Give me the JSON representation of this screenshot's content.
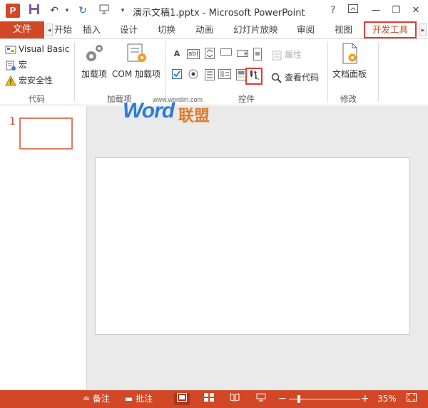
{
  "title_bar": {
    "app_badge": "P",
    "title": "演示文稿1.pptx - Microsoft PowerPoint",
    "help": "?",
    "minimize": "—",
    "restore": "❐",
    "close": "✕"
  },
  "tabs": {
    "file": "文件",
    "items": [
      "开始",
      "插入",
      "设计",
      "切换",
      "动画",
      "幻灯片放映",
      "审阅",
      "视图",
      "开发工具"
    ],
    "active": "开发工具"
  },
  "ribbon": {
    "code_group": {
      "label": "代码",
      "visual_basic": "Visual Basic",
      "macros": "宏",
      "macro_security": "宏安全性"
    },
    "addins_group": {
      "label": "加载项",
      "addins": "加载项",
      "com_addins": "COM 加载项"
    },
    "controls_group": {
      "label": "控件",
      "properties": "属性",
      "view_code": "查看代码"
    },
    "modify_group": {
      "label": "修改",
      "document_panel": "文档面板"
    }
  },
  "thumbnail": {
    "slide_number": "1"
  },
  "watermark": {
    "url": "www.wordlm.com",
    "main": "Word",
    "cn": "联盟"
  },
  "status_bar": {
    "notes": "备注",
    "comments": "批注",
    "zoom_percent": "35%",
    "zoom_level": 0.35
  },
  "colors": {
    "accent": "#d24726",
    "highlight": "#e53935"
  }
}
